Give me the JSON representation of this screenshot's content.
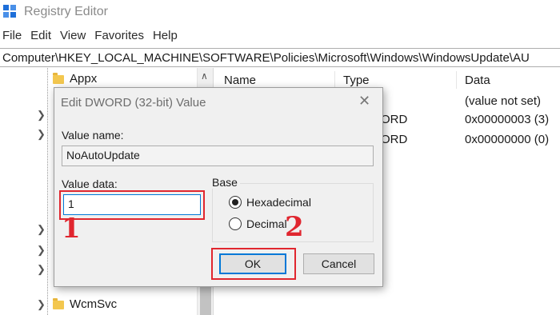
{
  "window": {
    "title": "Registry Editor",
    "icon": "registry-editor-icon"
  },
  "menu": [
    "File",
    "Edit",
    "View",
    "Favorites",
    "Help"
  ],
  "address": "Computer\\HKEY_LOCAL_MACHINE\\SOFTWARE\\Policies\\Microsoft\\Windows\\WindowsUpdate\\AU",
  "tree": {
    "top_item": "Appx",
    "bottom_item": "WcmSvc"
  },
  "list": {
    "columns": [
      "Name",
      "Type",
      "Data"
    ],
    "rows": [
      {
        "type": "",
        "data": "(value not set)"
      },
      {
        "type": "DWORD",
        "data": "0x00000003 (3)"
      },
      {
        "type": "DWORD",
        "data": "0x00000000 (0)"
      }
    ]
  },
  "dialog": {
    "title": "Edit DWORD (32-bit) Value",
    "value_name_label": "Value name:",
    "value_name": "NoAutoUpdate",
    "value_data_label": "Value data:",
    "value_data": "1",
    "base_label": "Base",
    "base_options": [
      {
        "label": "Hexadecimal",
        "selected": true
      },
      {
        "label": "Decimal",
        "selected": false
      }
    ],
    "ok_label": "OK",
    "cancel_label": "Cancel"
  },
  "annotations": {
    "step1": "1",
    "step2": "2",
    "highlight_color": "#e0262f"
  }
}
